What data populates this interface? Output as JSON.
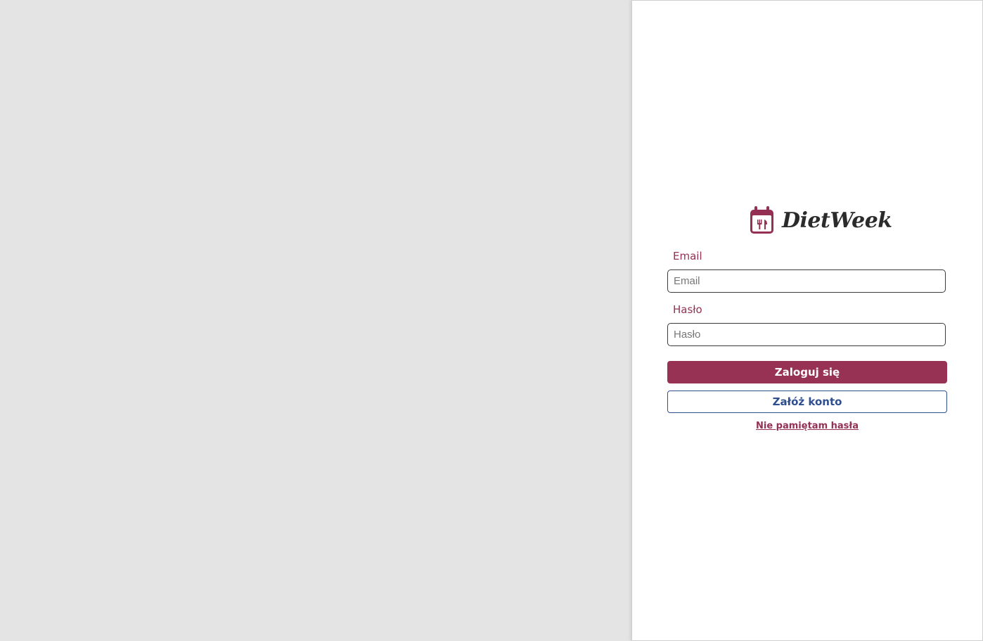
{
  "brand": {
    "name": "DietWeek",
    "icon": "calendar-cutlery-icon",
    "color": "#943054"
  },
  "form": {
    "email_label": "Email",
    "email_placeholder": "Email",
    "email_value": "",
    "password_label": "Hasło",
    "password_placeholder": "Hasło",
    "password_value": "",
    "login_button": "Zaloguj się",
    "register_button": "Załóż konto",
    "forgot_password_link": "Nie pamiętam hasła"
  },
  "colors": {
    "background": "#e4e4e4",
    "panel": "#ffffff",
    "primary": "#973255",
    "secondary": "#2f4f8f"
  }
}
